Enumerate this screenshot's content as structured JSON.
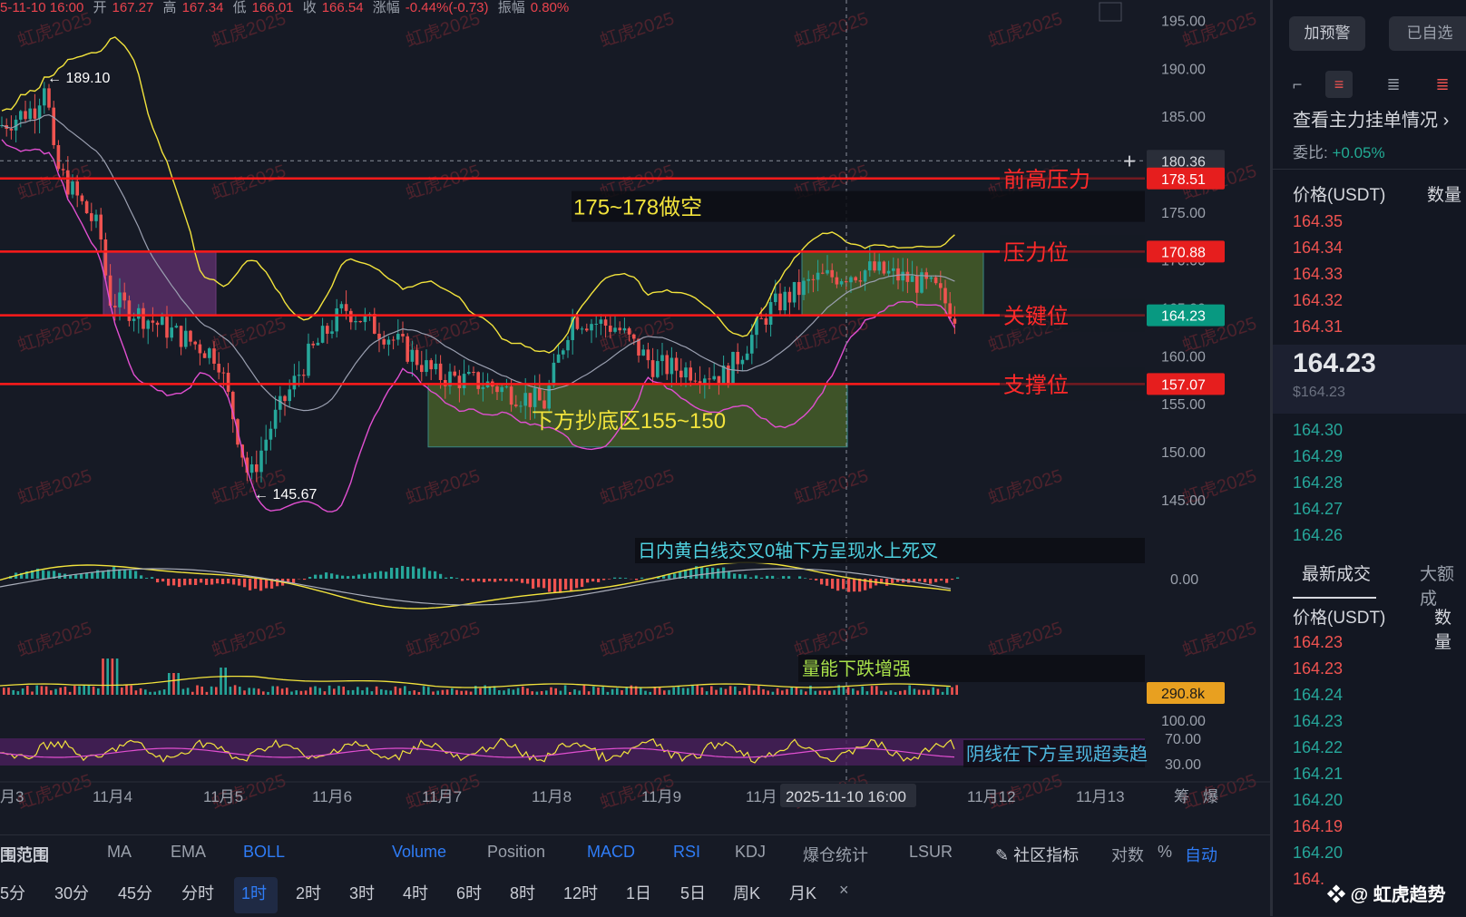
{
  "ohlc": {
    "date": "5-11-10 16:00",
    "open_label": "开",
    "open": "167.27",
    "high_label": "高",
    "high": "167.34",
    "low_label": "低",
    "low": "166.01",
    "close_label": "收",
    "close": "166.54",
    "change_label": "涨幅",
    "change": "-0.44%(-0.73)",
    "amp_label": "振幅",
    "amp": "0.80%"
  },
  "watermark": "虹虎2025",
  "chart_data": {
    "type": "candlestick",
    "y_axis": {
      "ticks": [
        "195.00",
        "190.00",
        "185.00",
        "180.00",
        "175.00",
        "170.00",
        "165.00",
        "160.00",
        "155.00",
        "150.00",
        "145.00"
      ],
      "ylim": [
        143,
        196
      ]
    },
    "x_axis": {
      "ticks": [
        "月3",
        "11月4",
        "11月5",
        "11月6",
        "11月7",
        "11月8",
        "11月9",
        "11月",
        "11月12",
        "11月13"
      ],
      "crosshair_time": "2025-11-10 16:00"
    },
    "price_labels": {
      "crosshair": "180.36",
      "prev_high": "178.51",
      "resistance": "170.88",
      "key": "164.23",
      "support": "157.07"
    },
    "levels": [
      {
        "name": "前高压力",
        "price": 178.51
      },
      {
        "name": "压力位",
        "price": 170.88
      },
      {
        "name": "关键位",
        "price": 164.23
      },
      {
        "name": "支撑位",
        "price": 157.07
      }
    ],
    "annotations": {
      "high_marker": "189.10",
      "low_marker": "145.67",
      "short_zone": "175~178做空",
      "buy_zone": "下方抄底区155~150",
      "macd_note": "日内黄白线交叉0轴下方呈现水上死叉",
      "vol_note": "量能下跌增强",
      "rsi_note": "阴线在下方呈现超卖趋"
    },
    "macd_tick": "0.00",
    "vol_label": "290.8k",
    "rsi_ticks": [
      "100.00",
      "70.00",
      "30.00"
    ],
    "colors": {
      "up": "#26a69a",
      "down": "#ef5350",
      "boll_upper": "#f2e33c",
      "boll_mid": "#9a9fb0",
      "boll_lower": "#e04fd0",
      "level": "#ff1a1a",
      "zone_green": "#5a7a2a"
    }
  },
  "toolbar": {
    "indicators": [
      "围范围",
      "MA",
      "EMA",
      "BOLL",
      "Volume",
      "Position",
      "MACD",
      "RSI",
      "KDJ",
      "爆仓统计",
      "LSUR"
    ],
    "community": "社区指标",
    "log": "对数",
    "pct": "%",
    "auto": "自动",
    "timeframes": [
      "5分",
      "30分",
      "45分",
      "分时",
      "1时",
      "2时",
      "3时",
      "4时",
      "6时",
      "8时",
      "12时",
      "1日",
      "5日",
      "周K",
      "月K"
    ],
    "active_tf": "1时",
    "close": "×",
    "right_labels": [
      "筹",
      "爆"
    ]
  },
  "right_panel": {
    "btn_alert": "加预警",
    "btn_fav": "已自选",
    "depth_link": "查看主力挂单情况",
    "ratio_label": "委比:",
    "ratio_value": "+0.05%",
    "price_header": "价格(USDT)",
    "qty_header": "数量",
    "asks": [
      "164.35",
      "164.34",
      "164.33",
      "164.32",
      "164.31"
    ],
    "last_price": "164.23",
    "last_price_usd": "$164.23",
    "bids": [
      "164.30",
      "164.29",
      "164.28",
      "164.27",
      "164.26"
    ],
    "tab_latest": "最新成交",
    "tab_large": "大额成",
    "trades_price_header": "价格(USDT)",
    "trades_qty_header": "数量",
    "trades": [
      {
        "price": "164.23",
        "side": "sell"
      },
      {
        "price": "164.23",
        "side": "sell"
      },
      {
        "price": "164.24",
        "side": "buy"
      },
      {
        "price": "164.23",
        "side": "buy"
      },
      {
        "price": "164.22",
        "side": "buy"
      },
      {
        "price": "164.21",
        "side": "buy"
      },
      {
        "price": "164.20",
        "side": "buy"
      },
      {
        "price": "164.19",
        "side": "sell"
      },
      {
        "price": "164.20",
        "side": "buy"
      },
      {
        "price": "164.",
        "side": "sell"
      }
    ],
    "brand": "@ 虹虎趋势"
  }
}
